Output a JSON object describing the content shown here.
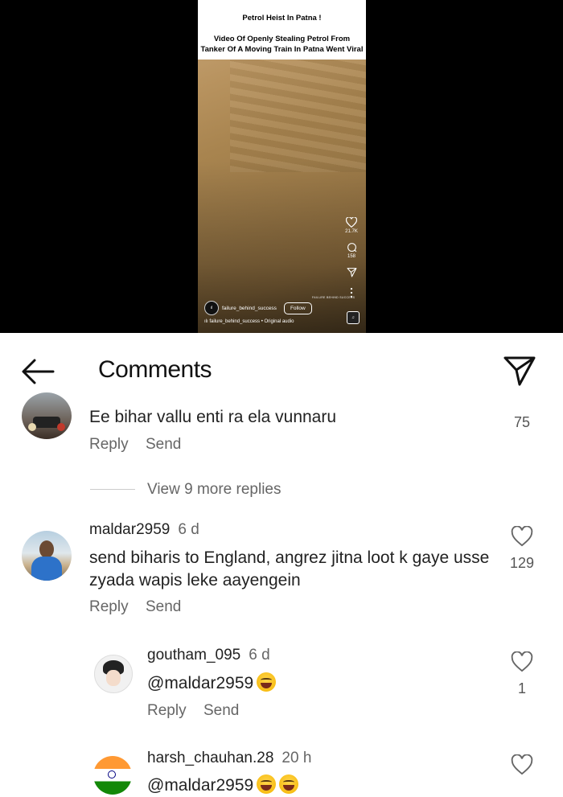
{
  "video": {
    "title_line1": "Petrol Heist In Patna !",
    "title_line2": "Video Of Openly Stealing Petrol From",
    "title_line3": "Tanker Of A Moving Train In Patna Went Viral",
    "likes": "21.7K",
    "comments": "158",
    "author": "failure_behind_success",
    "follow_label": "Follow",
    "audio": "failure_behind_success • Original audio",
    "brand_watermark": "FAILURE BEHIND SUCCESS"
  },
  "header": {
    "title": "Comments"
  },
  "comments": [
    {
      "text": "Ee bihar vallu enti ra ela vunnaru",
      "likes": "75",
      "reply_label": "Reply",
      "send_label": "Send",
      "view_more": "View 9 more replies"
    },
    {
      "username": "maldar2959",
      "age": "6 d",
      "text_line1": "send biharis to England, angrez jitna loot k gaye usse",
      "text_line2": "zyada wapis leke aayengein",
      "likes": "129",
      "reply_label": "Reply",
      "send_label": "Send"
    },
    {
      "username": "goutham_095",
      "age": "6 d",
      "mention": "@maldar2959",
      "likes": "1",
      "reply_label": "Reply",
      "send_label": "Send"
    },
    {
      "username": "harsh_chauhan.28",
      "age": "20 h",
      "mention": "@maldar2959"
    }
  ],
  "colors": {
    "video_bg": "#000000",
    "text": "#222222",
    "muted": "#666666"
  }
}
